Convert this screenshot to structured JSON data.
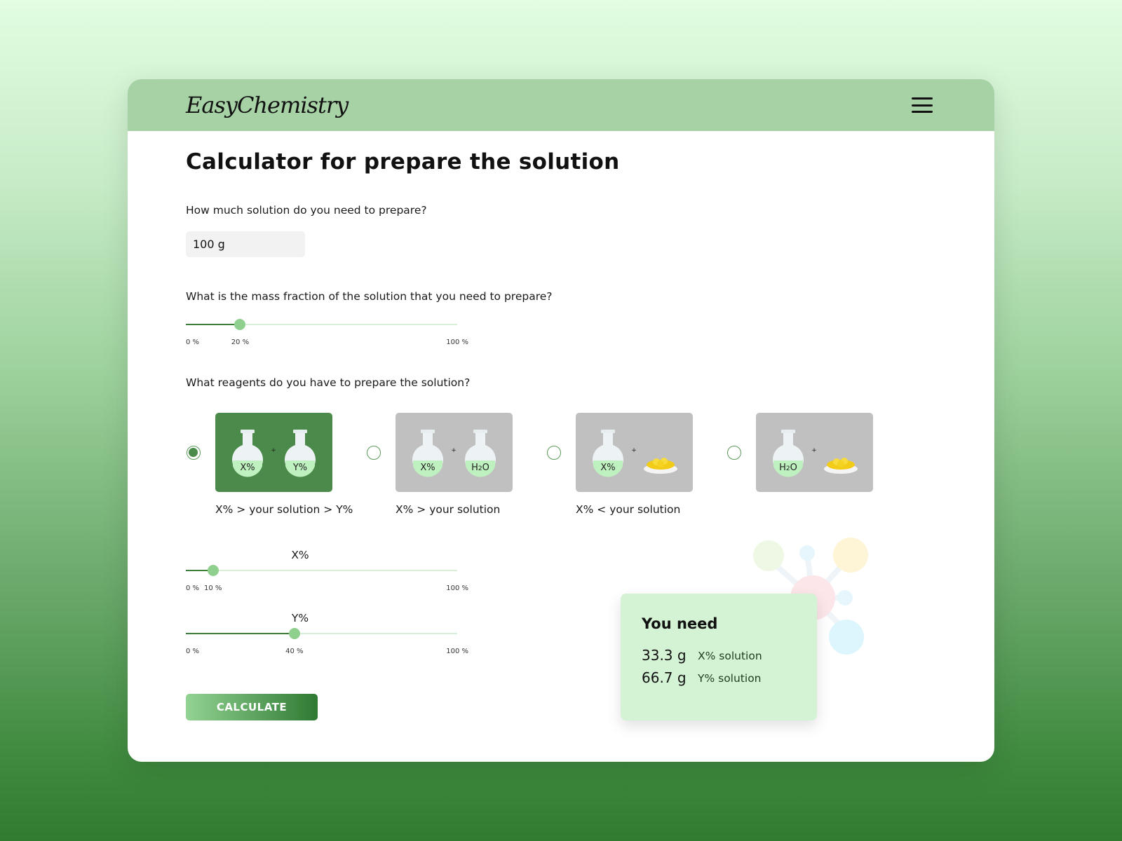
{
  "app": {
    "logo": "EasyChemistry",
    "menu_icon": "hamburger-icon"
  },
  "page": {
    "title": "Calculator for prepare the solution"
  },
  "q1": {
    "label": "How much solution do you need to prepare?",
    "value": "100 g"
  },
  "q2": {
    "label": "What is the mass fraction of the solution that you need to prepare?",
    "value_percent": 20,
    "min_label": "0 %",
    "value_label": "20 %",
    "max_label": "100 %"
  },
  "q3": {
    "label": "What reagents do you have to prepare the solution?",
    "options": [
      {
        "left": "X%",
        "right": "Y%",
        "caption": "X% > your solution > Y%",
        "selected": true
      },
      {
        "left": "X%",
        "right": "H2O",
        "caption": "X% > your solution",
        "selected": false
      },
      {
        "left": "X%",
        "right": "solid",
        "caption": "X% < your solution",
        "selected": false
      },
      {
        "left": "H2O",
        "right": "solid",
        "caption": "",
        "selected": false
      }
    ],
    "plus": "+"
  },
  "x_slider": {
    "label": "X%",
    "value_percent": 10,
    "min_label": "0 %",
    "value_label": "10 %",
    "max_label": "100 %"
  },
  "y_slider": {
    "label": "Y%",
    "value_percent": 40,
    "min_label": "0 %",
    "value_label": "40 %",
    "max_label": "100 %"
  },
  "calculate_label": "CALCULATE",
  "result": {
    "title": "You need",
    "rows": [
      {
        "amount": "33.3 g",
        "label": "X% solution"
      },
      {
        "amount": "66.7 g",
        "label": "Y% solution"
      }
    ]
  },
  "colors": {
    "header": "#a6d2a6",
    "accent": "#4b8a4b",
    "thumb": "#8fd08f",
    "result_bg": "#d4f2d4"
  }
}
